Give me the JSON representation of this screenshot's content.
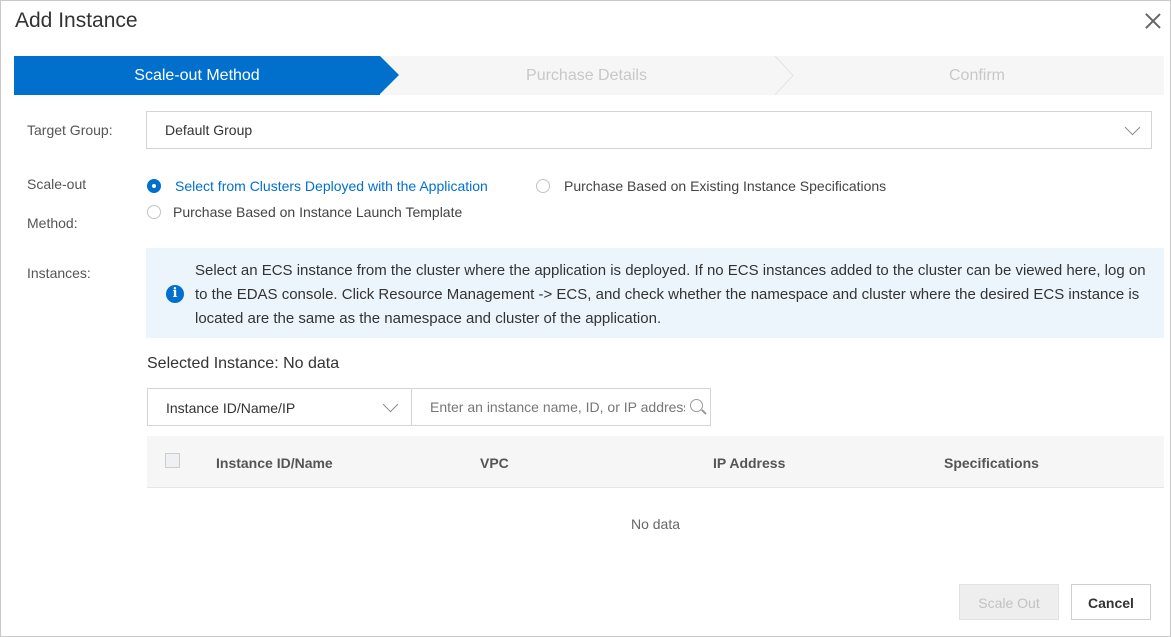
{
  "dialog": {
    "title": "Add Instance"
  },
  "steps": [
    "Scale-out Method",
    "Purchase Details",
    "Confirm"
  ],
  "form": {
    "target_group_label": "Target Group:",
    "target_group_value": "Default Group",
    "scaleout_label_line1": "Scale-out",
    "scaleout_label_line2": "Method:",
    "methods": [
      {
        "label": "Select from Clusters Deployed with the Application",
        "selected": true
      },
      {
        "label": "Purchase Based on Existing Instance Specifications",
        "selected": false
      },
      {
        "label": "Purchase Based on Instance Launch Template",
        "selected": false
      }
    ],
    "instances_label": "Instances:"
  },
  "notice": {
    "icon": "info-icon",
    "text": "Select an ECS instance from the cluster where the application is deployed. If no ECS instances added to the cluster can be viewed here, log on to the EDAS console. Click Resource Management -> ECS, and check whether the namespace and cluster where the desired ECS instance is located are the same as the namespace and cluster of the application."
  },
  "selected_instance": "Selected Instance: No data",
  "filter": {
    "field": "Instance ID/Name/IP",
    "search_placeholder": "Enter an instance name, ID, or IP address"
  },
  "table": {
    "columns": [
      "Instance ID/Name",
      "VPC",
      "IP Address",
      "Specifications"
    ],
    "empty_text": "No data"
  },
  "buttons": {
    "scale_out": "Scale Out",
    "cancel": "Cancel"
  },
  "colors": {
    "primary": "#0070cc",
    "notice_bg": "#edf5fc"
  }
}
